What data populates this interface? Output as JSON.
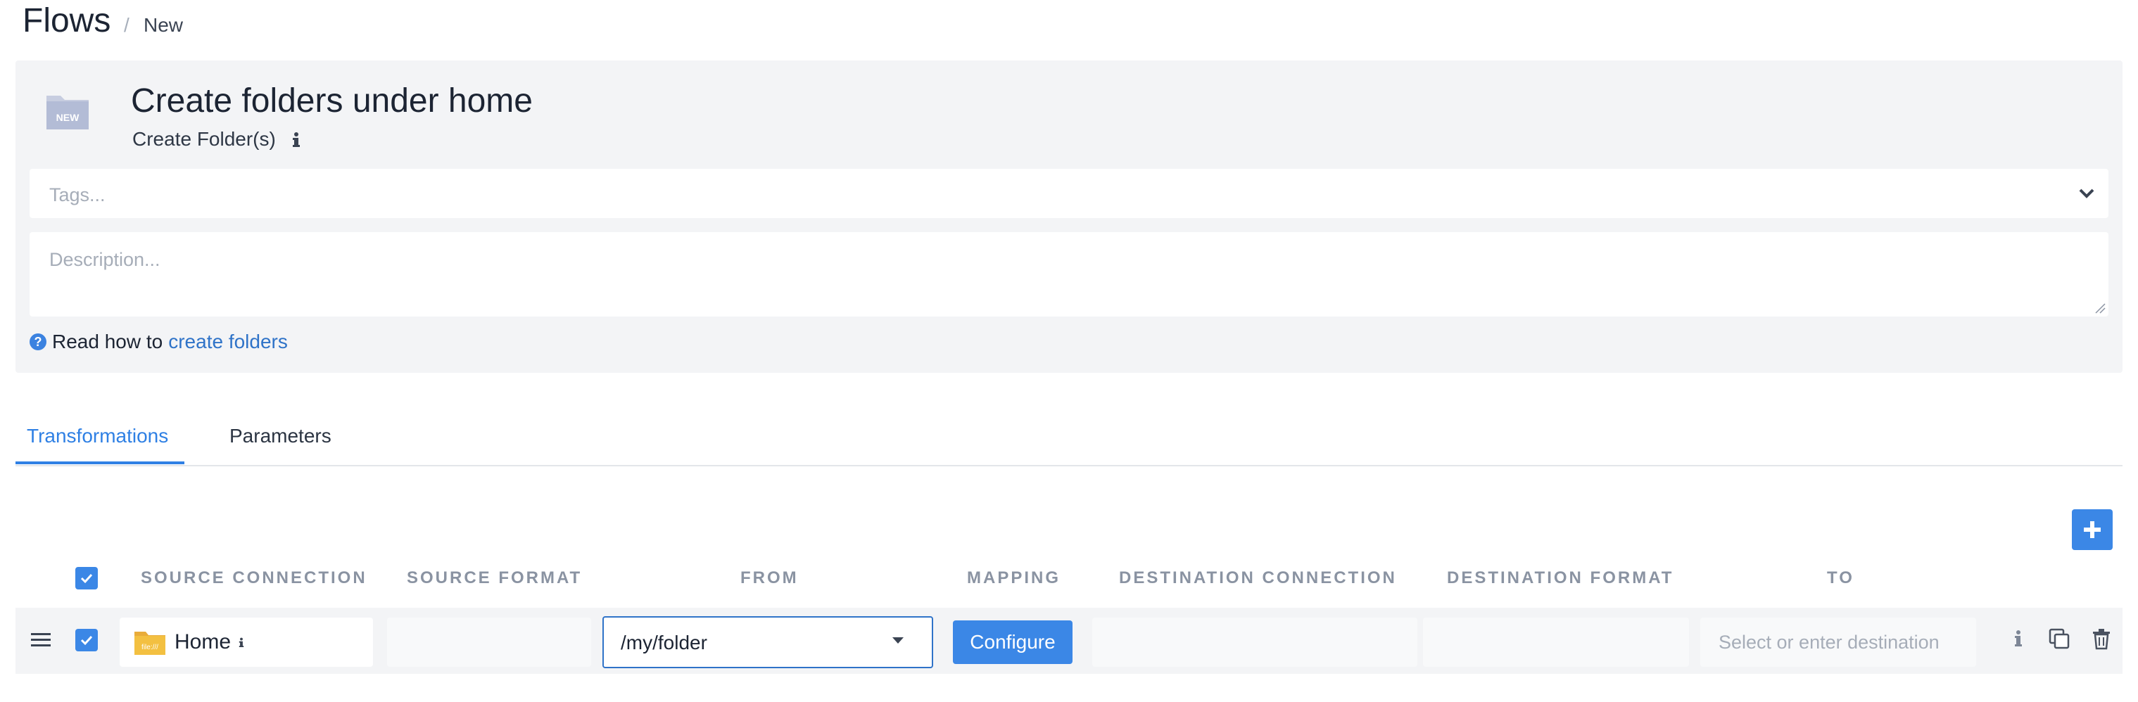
{
  "breadcrumb": {
    "title": "Flows",
    "separator": "/",
    "current": "New"
  },
  "header": {
    "icon_label": "NEW",
    "flow_name": "Create folders under home",
    "flow_type": "Create Folder(s)",
    "tags_placeholder": "Tags...",
    "description_placeholder": "Description...",
    "help_prefix": "Read how to",
    "help_link": "create folders"
  },
  "tabs": [
    {
      "label": "Transformations",
      "active": true
    },
    {
      "label": "Parameters",
      "active": false
    }
  ],
  "table": {
    "headers": [
      "SOURCE CONNECTION",
      "SOURCE FORMAT",
      "FROM",
      "MAPPING",
      "DESTINATION CONNECTION",
      "DESTINATION FORMAT",
      "TO"
    ],
    "rows": [
      {
        "source_connection": "Home",
        "source_icon_label": "file:///",
        "from": "/my/folder",
        "mapping_button": "Configure",
        "to_placeholder": "Select or enter destination"
      }
    ]
  },
  "colors": {
    "accent": "#3b87e6",
    "link": "#2f73c8",
    "panel": "#f3f4f6"
  },
  "icons": [
    "new-folder-icon",
    "info-icon",
    "chevron-down-icon",
    "question-icon",
    "plus-icon",
    "checkbox-icon",
    "drag-handle-icon",
    "folder-icon",
    "copy-icon",
    "trash-icon"
  ]
}
